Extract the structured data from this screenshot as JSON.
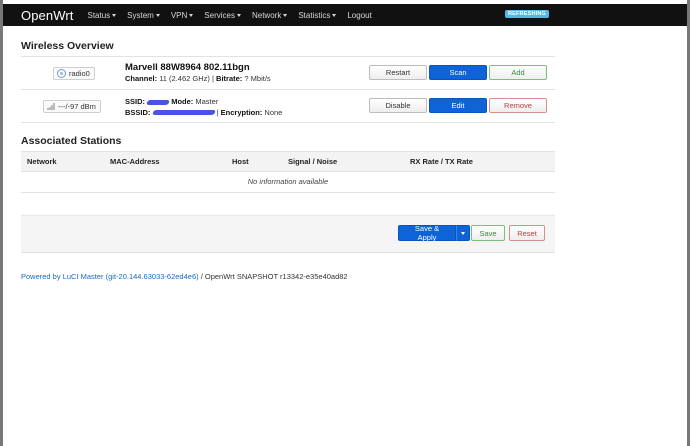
{
  "header": {
    "brand": "OpenWrt",
    "menu": [
      "Status",
      "System",
      "VPN",
      "Services",
      "Network",
      "Statistics",
      "Logout"
    ],
    "badge": "REFRESHING"
  },
  "wireless_overview": {
    "title": "Wireless Overview",
    "device": {
      "badge": "radio0",
      "name": "Marvell 88W8964 802.11bgn",
      "channel_label": "Channel:",
      "channel_value": "11 (2.462 GHz)",
      "bitrate_label": "Bitrate:",
      "bitrate_value": "? Mbit/s",
      "buttons": {
        "restart": "Restart",
        "scan": "Scan",
        "add": "Add"
      }
    },
    "network": {
      "signal_badge": "---/-97 dBm",
      "ssid_label": "SSID:",
      "mode_label": "Mode:",
      "mode_value": "Master",
      "bssid_label": "BSSID:",
      "encryption_label": "Encryption:",
      "encryption_value": "None",
      "buttons": {
        "disable": "Disable",
        "edit": "Edit",
        "remove": "Remove"
      }
    }
  },
  "associated_stations": {
    "title": "Associated Stations",
    "columns": [
      "Network",
      "MAC-Address",
      "Host",
      "Signal / Noise",
      "RX Rate / TX Rate"
    ],
    "empty_text": "No information available"
  },
  "actions": {
    "save_apply": "Save & Apply",
    "save": "Save",
    "reset": "Reset"
  },
  "footer": {
    "link_text": "Powered by LuCI Master (git-20.144.63033-62ed4e6)",
    "rest_text": "/ OpenWrt SNAPSHOT r13342-e35e40ad82"
  },
  "colors": {
    "primary": "#0e64d6",
    "topbar": "#111111",
    "badge": "#56b8e6",
    "link": "#1a6ac2"
  }
}
